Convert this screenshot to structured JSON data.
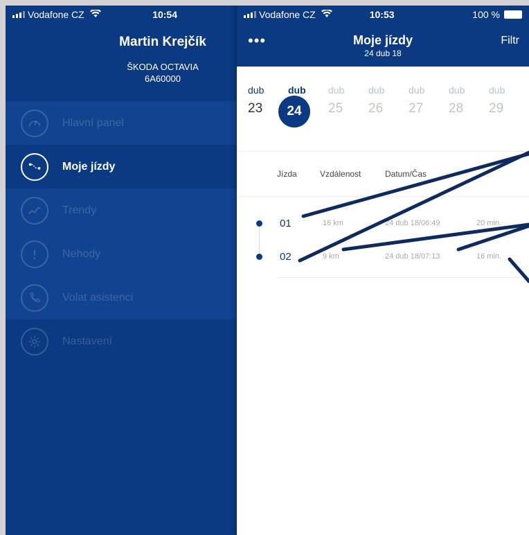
{
  "left": {
    "status": {
      "carrier": "Vodafone CZ",
      "time": "10:54"
    },
    "user_name": "Martin Krejčík",
    "car_model": "ŠKODA OCTAVIA",
    "car_plate": "6A60000",
    "menu": [
      {
        "label": "Hlavní panel",
        "icon": "speedometer-icon"
      },
      {
        "label": "Moje jízdy",
        "icon": "route-icon"
      },
      {
        "label": "Trendy",
        "icon": "trend-icon"
      },
      {
        "label": "Nehody",
        "icon": "alert-icon"
      },
      {
        "label": "Volat asistenci",
        "icon": "phone-icon"
      },
      {
        "label": "Nastavení",
        "icon": "gear-icon"
      }
    ],
    "active_index": 1
  },
  "right": {
    "status": {
      "carrier": "Vodafone CZ",
      "time": "10:53",
      "battery": "100 %"
    },
    "title": "Moje jízdy",
    "subtitle": "24 dub 18",
    "menu_dots": "•••",
    "filter_label": "Filtr",
    "calendar": [
      {
        "month": "dub",
        "day": "23",
        "state": "past"
      },
      {
        "month": "dub",
        "day": "24",
        "state": "selected"
      },
      {
        "month": "dub",
        "day": "25",
        "state": "future"
      },
      {
        "month": "dub",
        "day": "26",
        "state": "future"
      },
      {
        "month": "dub",
        "day": "27",
        "state": "future"
      },
      {
        "month": "dub",
        "day": "28",
        "state": "future"
      },
      {
        "month": "dub",
        "day": "29",
        "state": "future"
      }
    ],
    "columns": {
      "trip": "Jízda",
      "distance": "Vzdálenost",
      "datetime": "Datum/Čas",
      "duration": ""
    },
    "trips": [
      {
        "id": "01",
        "distance": "16 km",
        "datetime": "24 dub 18/06:49",
        "duration": "20 min."
      },
      {
        "id": "02",
        "distance": "9 km",
        "datetime": "24 dub 18/07:13",
        "duration": "16 min."
      }
    ]
  },
  "colors": {
    "brand_blue": "#0b3a82",
    "annotation": "#0f2a5c"
  }
}
